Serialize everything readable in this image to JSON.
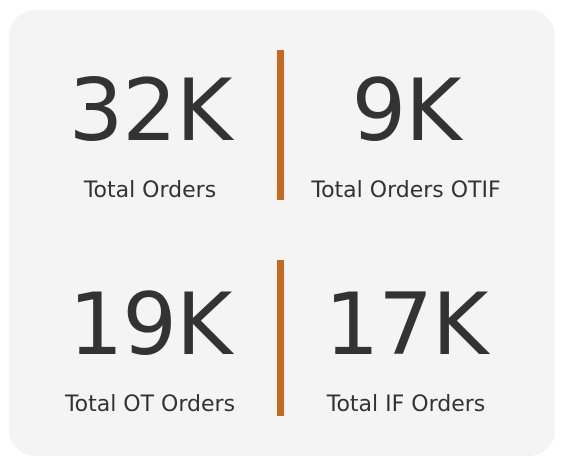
{
  "kpis": [
    {
      "value": "32K",
      "label": "Total Orders"
    },
    {
      "value": "9K",
      "label": "Total Orders OTIF"
    },
    {
      "value": "19K",
      "label": "Total OT Orders"
    },
    {
      "value": "17K",
      "label": "Total IF Orders"
    }
  ],
  "colors": {
    "card_background": "#f4f4f4",
    "divider": "#c56a1f",
    "text": "#333333"
  }
}
